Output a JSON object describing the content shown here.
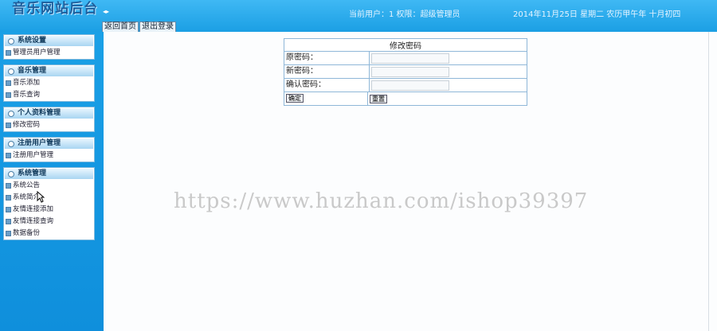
{
  "header": {
    "logo": "音乐网站后台",
    "toggle": "◂▸",
    "nav": {
      "home": "返回首页",
      "logout": "退出登录"
    },
    "user_info": "当前用户：1 权限：超级管理员",
    "date_info": "2014年11月25日  星期二  农历甲午年 十月初四"
  },
  "sidebar": {
    "sections": [
      {
        "title": "系统设置",
        "items": [
          "管理员用户管理"
        ]
      },
      {
        "title": "音乐管理",
        "items": [
          "音乐添加",
          "音乐查询"
        ]
      },
      {
        "title": "个人资料管理",
        "items": [
          "修改密码"
        ]
      },
      {
        "title": "注册用户管理",
        "items": [
          "注册用户管理"
        ]
      },
      {
        "title": "系统管理",
        "items": [
          "系统公告",
          "系统简介",
          "友情连接添加",
          "友情连接查询",
          "数据备份"
        ]
      }
    ]
  },
  "form": {
    "title": "修改密码",
    "old_label": "原密码：",
    "new_label": "新密码：",
    "confirm_label": "确认密码：",
    "old_value": "",
    "new_value": "",
    "confirm_value": "",
    "submit_label": "确定",
    "reset_label": "重置"
  },
  "watermark": "https://www.huzhan.com/ishop39397",
  "colors": {
    "header": "#1ca0e5",
    "sidebar": "#1197de",
    "panel_border": "#7fb8dc"
  }
}
